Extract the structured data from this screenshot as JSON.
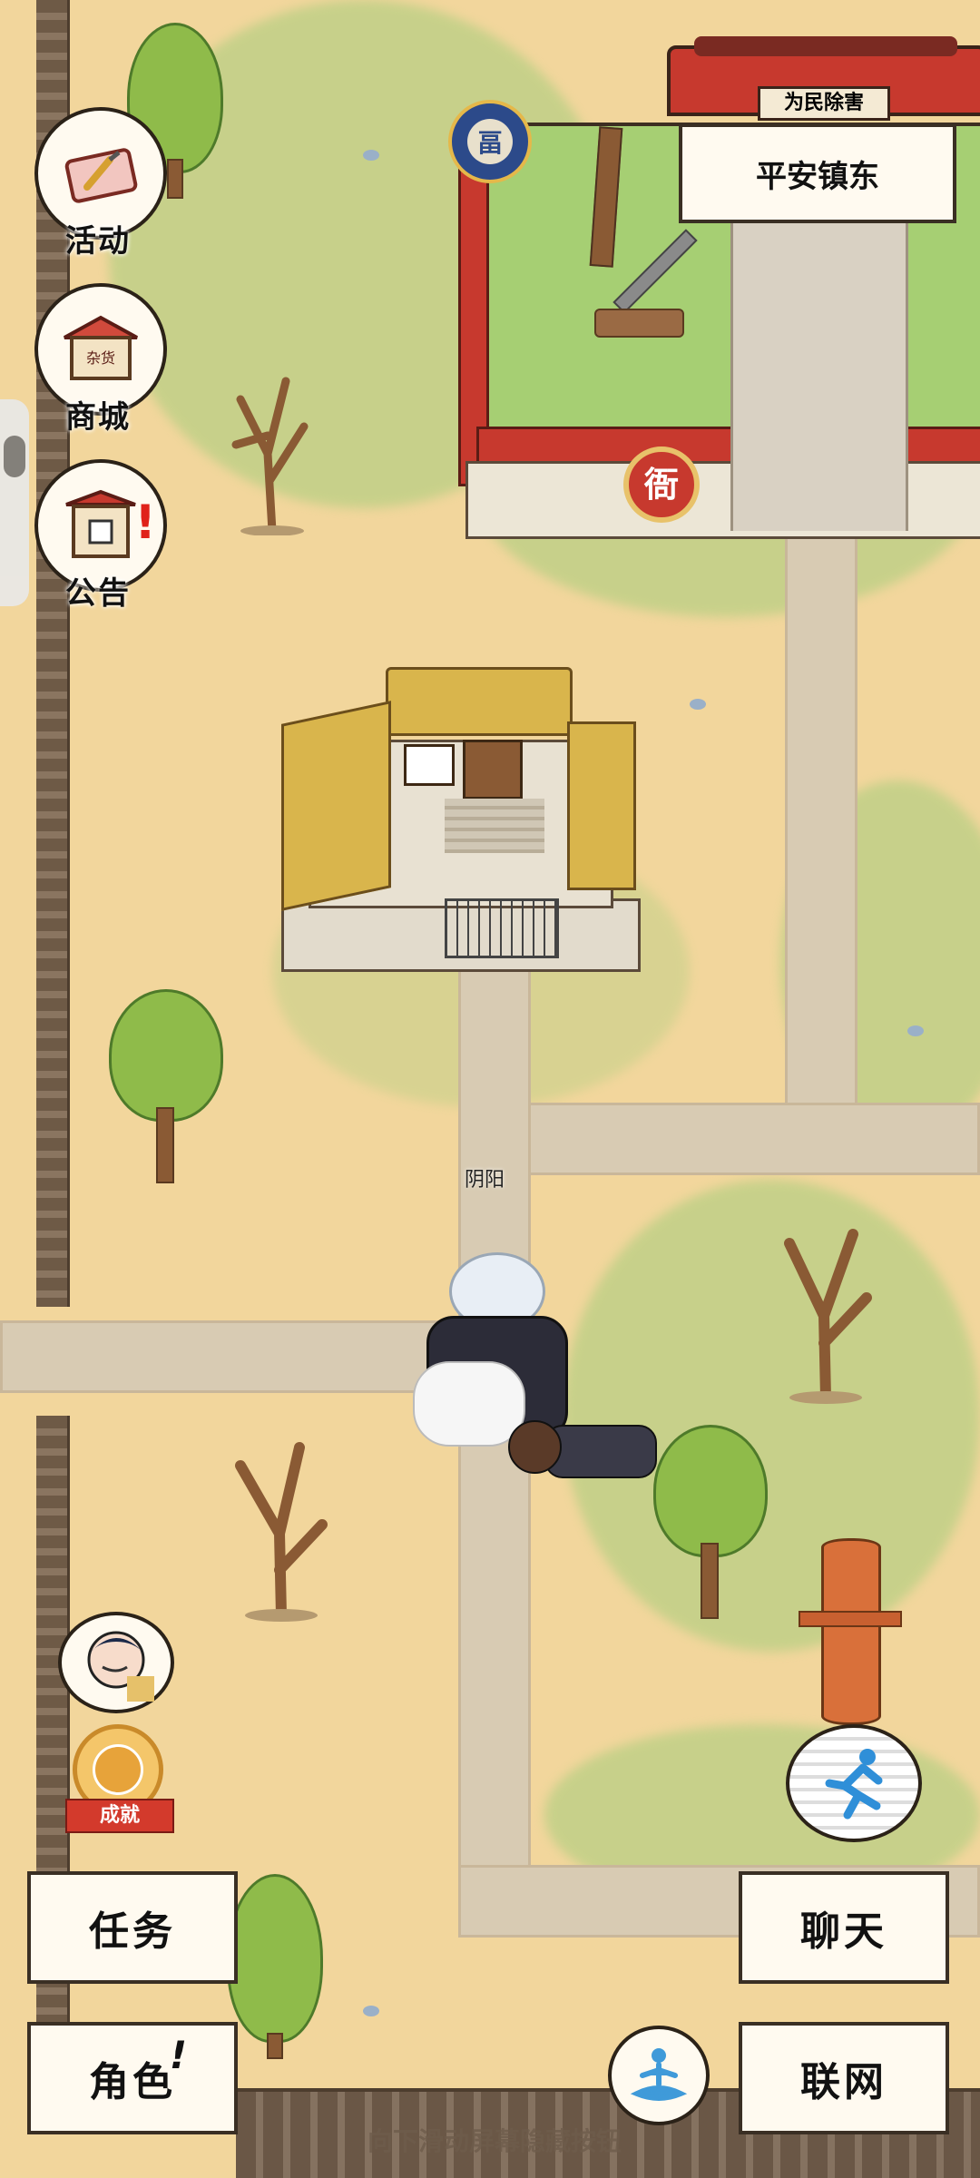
{
  "location_sign": "平安镇东",
  "path_label": "阴阳",
  "side_menu": [
    {
      "label": "活动",
      "icon": "event-scroll-icon"
    },
    {
      "label": "商城",
      "icon": "shop-stall-icon"
    },
    {
      "label": "公告",
      "icon": "notice-board-icon"
    }
  ],
  "achievement_badge": "成就",
  "buttons": {
    "task": "任务",
    "role": "角色",
    "role_alert": "!",
    "chat": "聊天",
    "network": "联网"
  },
  "hint": "向下滑动屏幕隐藏按钮",
  "yamen_plaque": "为民除害",
  "yamen_seal": "衙",
  "shop_sign": "杂货"
}
